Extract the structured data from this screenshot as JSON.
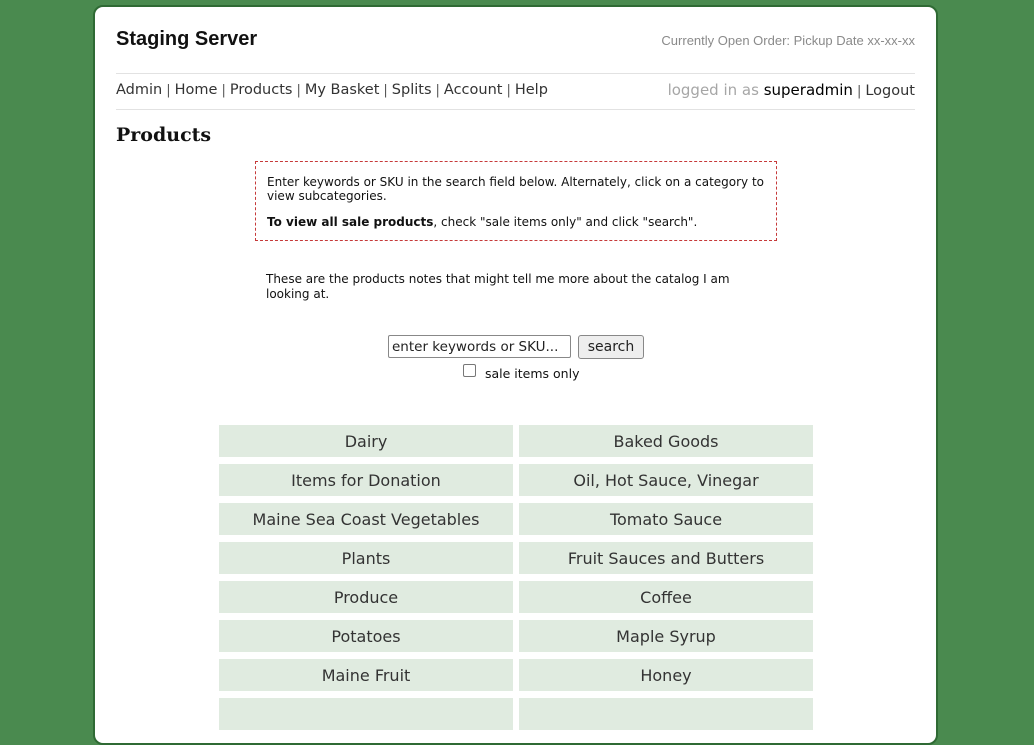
{
  "header": {
    "site_title": "Staging Server",
    "open_order": "Currently Open Order: Pickup Date xx-xx-xx"
  },
  "nav": {
    "items": [
      "Admin",
      "Home",
      "Products",
      "My Basket",
      "Splits",
      "Account",
      "Help"
    ],
    "separator": "|"
  },
  "account": {
    "logged_in_text": "logged in as",
    "username": "superadmin",
    "logout_label": "Logout"
  },
  "page_title": "Products",
  "notice": {
    "line1": "Enter keywords or SKU in the search field below. Alternately, click on a category to view subcategories.",
    "bold": "To view all sale products",
    "rest": ", check \"sale items only\" and click \"search\"."
  },
  "notes": "These are the products notes that might tell me more about the catalog I am looking at.",
  "search": {
    "placeholder": "enter keywords or SKU...",
    "button_label": "search",
    "sale_only_label": "sale items only",
    "sale_only_checked": false
  },
  "categories": [
    "Dairy",
    "Baked Goods",
    "Items for Donation",
    "Oil, Hot Sauce, Vinegar",
    "Maine Sea Coast Vegetables",
    "Tomato Sauce",
    "Plants",
    "Fruit Sauces and Butters",
    "Produce",
    "Coffee",
    "Potatoes",
    "Maple Syrup",
    "Maine Fruit",
    "Honey"
  ],
  "colors": {
    "background": "#4a8a4f",
    "category_tile": "#e0ebe0",
    "notice_border": "#c63a3a"
  }
}
